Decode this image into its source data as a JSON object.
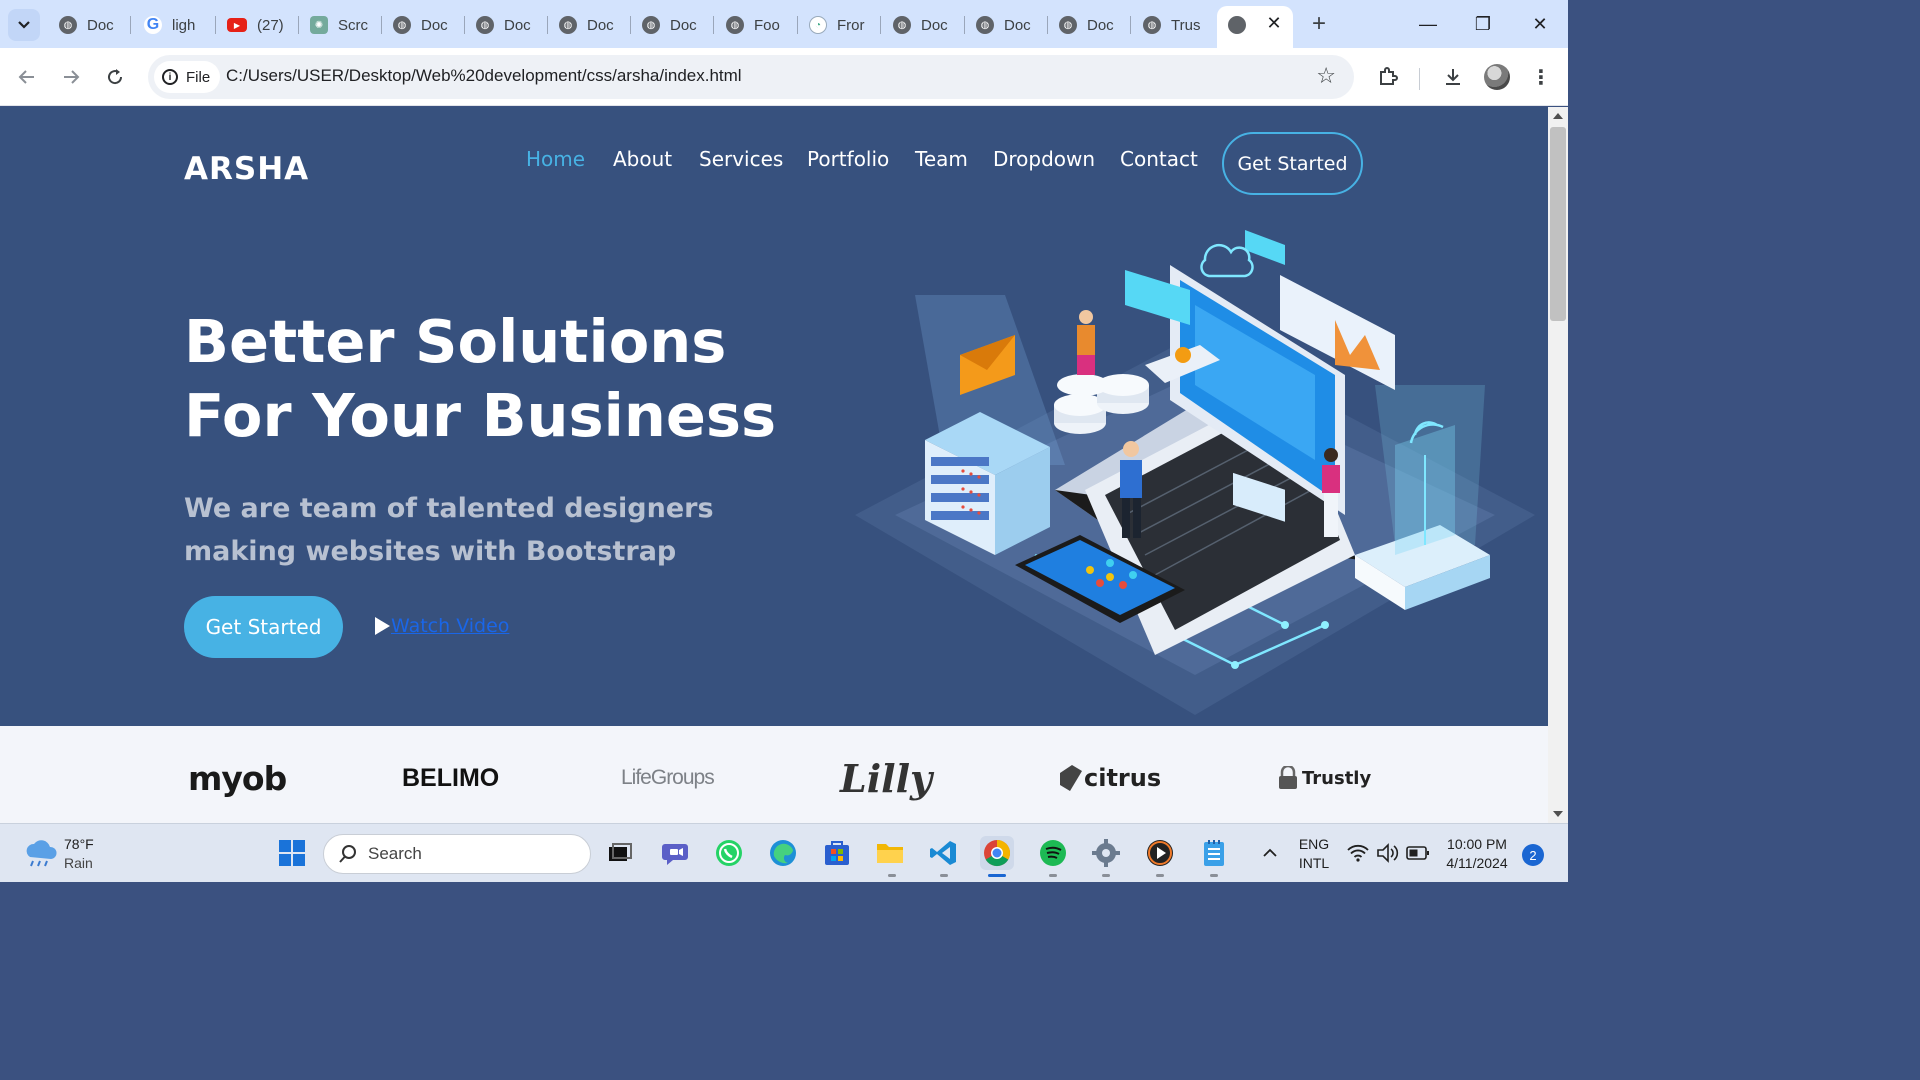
{
  "browser": {
    "tabs": [
      {
        "title": "Doc",
        "icon": "globe-icon"
      },
      {
        "title": "ligh",
        "icon": "google-icon"
      },
      {
        "title": "(27)",
        "icon": "youtube-icon"
      },
      {
        "title": "Scrc",
        "icon": "chatgpt-icon"
      },
      {
        "title": "Doc",
        "icon": "globe-icon"
      },
      {
        "title": "Doc",
        "icon": "globe-icon"
      },
      {
        "title": "Doc",
        "icon": "globe-icon"
      },
      {
        "title": "Doc",
        "icon": "globe-icon"
      },
      {
        "title": "Foo",
        "icon": "globe-icon"
      },
      {
        "title": "Fror",
        "icon": "frontend-icon"
      },
      {
        "title": "Doc",
        "icon": "globe-icon"
      },
      {
        "title": "Doc",
        "icon": "globe-icon"
      },
      {
        "title": "Doc",
        "icon": "globe-icon"
      },
      {
        "title": "Trus",
        "icon": "globe-icon"
      }
    ],
    "active_tab": {
      "icon": "globe-icon",
      "close": "✕"
    },
    "new_tab": "+",
    "window_controls": {
      "minimize": "—",
      "maximize": "❐",
      "close": "✕"
    },
    "chip_label": "File",
    "url": "C:/Users/USER/Desktop/Web%20development/css/arsha/index.html"
  },
  "site": {
    "logo": "ARSHA",
    "nav": [
      "Home",
      "About",
      "Services",
      "Portfolio",
      "Team",
      "Dropdown",
      "Contact"
    ],
    "nav_active": "Home",
    "nav_cta": "Get Started",
    "headline": "Better Solutions For Your Business",
    "subheadline": "We are team of talented designers making websites with Bootstrap",
    "hero_cta": "Get Started",
    "watch_video": "Watch Video",
    "clients": [
      "myob",
      "BELIMO",
      "LifeGroups",
      "Lilly",
      "citrus",
      "Trustly"
    ],
    "colors": {
      "hero_bg": "#37517e",
      "accent": "#47b2e4",
      "link": "#1a66e8"
    }
  },
  "taskbar": {
    "weather_temp": "78°F",
    "weather_cond": "Rain",
    "search_placeholder": "Search",
    "lang_line1": "ENG",
    "lang_line2": "INTL",
    "time": "10:00 PM",
    "date": "4/11/2024",
    "notifications": "2"
  }
}
